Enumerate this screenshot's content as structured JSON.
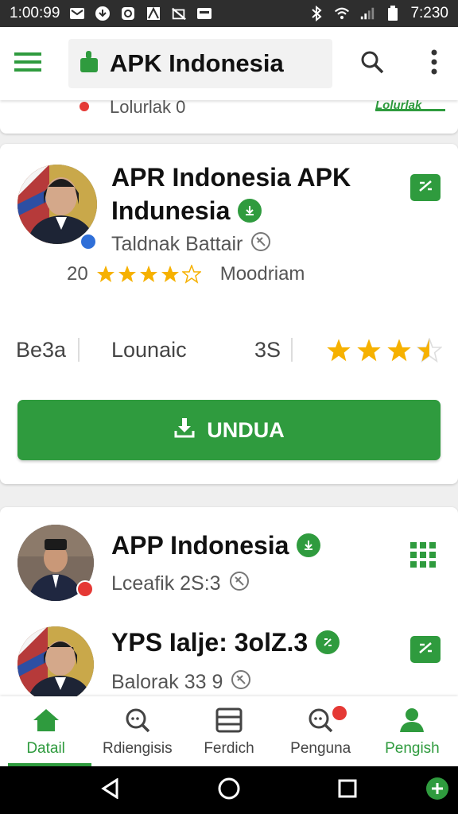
{
  "status_bar": {
    "time_left": "1:00:99",
    "time_right": "7:230"
  },
  "app_bar": {
    "title": "APK Indonesia"
  },
  "peek_card": {
    "text": "Lolurlak 0",
    "tag": "Lolurlak"
  },
  "cards": [
    {
      "title_line1": "APR Indonesia APK",
      "title_line2": "Indunesia",
      "subtitle": "Taldnak Battair",
      "rating_count": "20",
      "rating_stars": 4,
      "rating_label": "Moodriam",
      "stats": [
        "Be3a",
        "Lounaic",
        "3S"
      ],
      "stat_stars": 3.5,
      "button_label": "UNDUA"
    },
    {
      "title": "APP Indonesia",
      "subtitle": "Lceafik 2S:3"
    },
    {
      "title": "YPS Ialje: 3olZ.3",
      "subtitle": "Balorak 33 9"
    }
  ],
  "bottom_nav": {
    "items": [
      {
        "label": "Datail",
        "icon": "home-icon",
        "active": true
      },
      {
        "label": "Rdiengisis",
        "icon": "search-chat-icon",
        "active": false
      },
      {
        "label": "Ferdich",
        "icon": "list-icon",
        "active": false
      },
      {
        "label": "Penguna",
        "icon": "search-chat-icon",
        "active": false,
        "badge": true
      },
      {
        "label": "Pengish",
        "icon": "person-icon",
        "active": false
      }
    ]
  },
  "colors": {
    "accent": "#2f9b3e",
    "star": "#f6b100",
    "badge": "#e53935"
  }
}
